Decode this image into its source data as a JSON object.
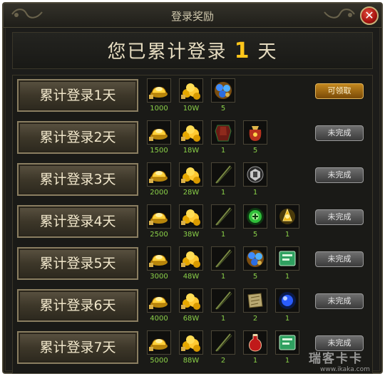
{
  "window": {
    "title": "登录奖励",
    "close_symbol": "✕"
  },
  "summary": {
    "prefix": "您已累计登录",
    "days": "1",
    "suffix": "天"
  },
  "rows": [
    {
      "label": "累计登录1天",
      "status": "可领取",
      "claimable": true,
      "items": [
        {
          "icon": "gold-ingot-icon",
          "qty": "1000"
        },
        {
          "icon": "gold-pile-icon",
          "qty": "10W"
        },
        {
          "icon": "blue-gem-icon",
          "qty": "5"
        }
      ]
    },
    {
      "label": "累计登录2天",
      "status": "未完成",
      "claimable": false,
      "items": [
        {
          "icon": "gold-ingot-icon",
          "qty": "1500"
        },
        {
          "icon": "gold-pile-icon",
          "qty": "18W"
        },
        {
          "icon": "red-armor-icon",
          "qty": "1"
        },
        {
          "icon": "red-bag-icon",
          "qty": "5"
        }
      ]
    },
    {
      "label": "累计登录3天",
      "status": "未完成",
      "claimable": false,
      "items": [
        {
          "icon": "gold-ingot-icon",
          "qty": "2000"
        },
        {
          "icon": "gold-pile-icon",
          "qty": "28W"
        },
        {
          "icon": "staff-icon",
          "qty": "1"
        },
        {
          "icon": "emblem-icon",
          "qty": "1"
        }
      ]
    },
    {
      "label": "累计登录4天",
      "status": "未完成",
      "claimable": false,
      "items": [
        {
          "icon": "gold-ingot-icon",
          "qty": "2500"
        },
        {
          "icon": "gold-pile-icon",
          "qty": "38W"
        },
        {
          "icon": "staff-icon",
          "qty": "1"
        },
        {
          "icon": "green-orb-icon",
          "qty": "5"
        },
        {
          "icon": "gold-rune-icon",
          "qty": "1"
        }
      ]
    },
    {
      "label": "累计登录5天",
      "status": "未完成",
      "claimable": false,
      "items": [
        {
          "icon": "gold-ingot-icon",
          "qty": "3000"
        },
        {
          "icon": "gold-pile-icon",
          "qty": "48W"
        },
        {
          "icon": "staff-icon",
          "qty": "1"
        },
        {
          "icon": "blue-gem-icon",
          "qty": "5"
        },
        {
          "icon": "green-book-icon",
          "qty": "1"
        }
      ]
    },
    {
      "label": "累计登录6天",
      "status": "未完成",
      "claimable": false,
      "items": [
        {
          "icon": "gold-ingot-icon",
          "qty": "4000"
        },
        {
          "icon": "gold-pile-icon",
          "qty": "68W"
        },
        {
          "icon": "staff-icon",
          "qty": "1"
        },
        {
          "icon": "scroll-icon",
          "qty": "2"
        },
        {
          "icon": "blue-orb-icon",
          "qty": "1"
        }
      ]
    },
    {
      "label": "累计登录7天",
      "status": "未完成",
      "claimable": false,
      "items": [
        {
          "icon": "gold-ingot-icon",
          "qty": "5000"
        },
        {
          "icon": "gold-pile-icon",
          "qty": "88W"
        },
        {
          "icon": "staff-icon",
          "qty": "2"
        },
        {
          "icon": "red-potion-icon",
          "qty": "1"
        },
        {
          "icon": "green-book-icon",
          "qty": "1"
        }
      ]
    }
  ],
  "watermark": {
    "main": "瑞客卡卡",
    "sub": "www.ikaka.com"
  }
}
